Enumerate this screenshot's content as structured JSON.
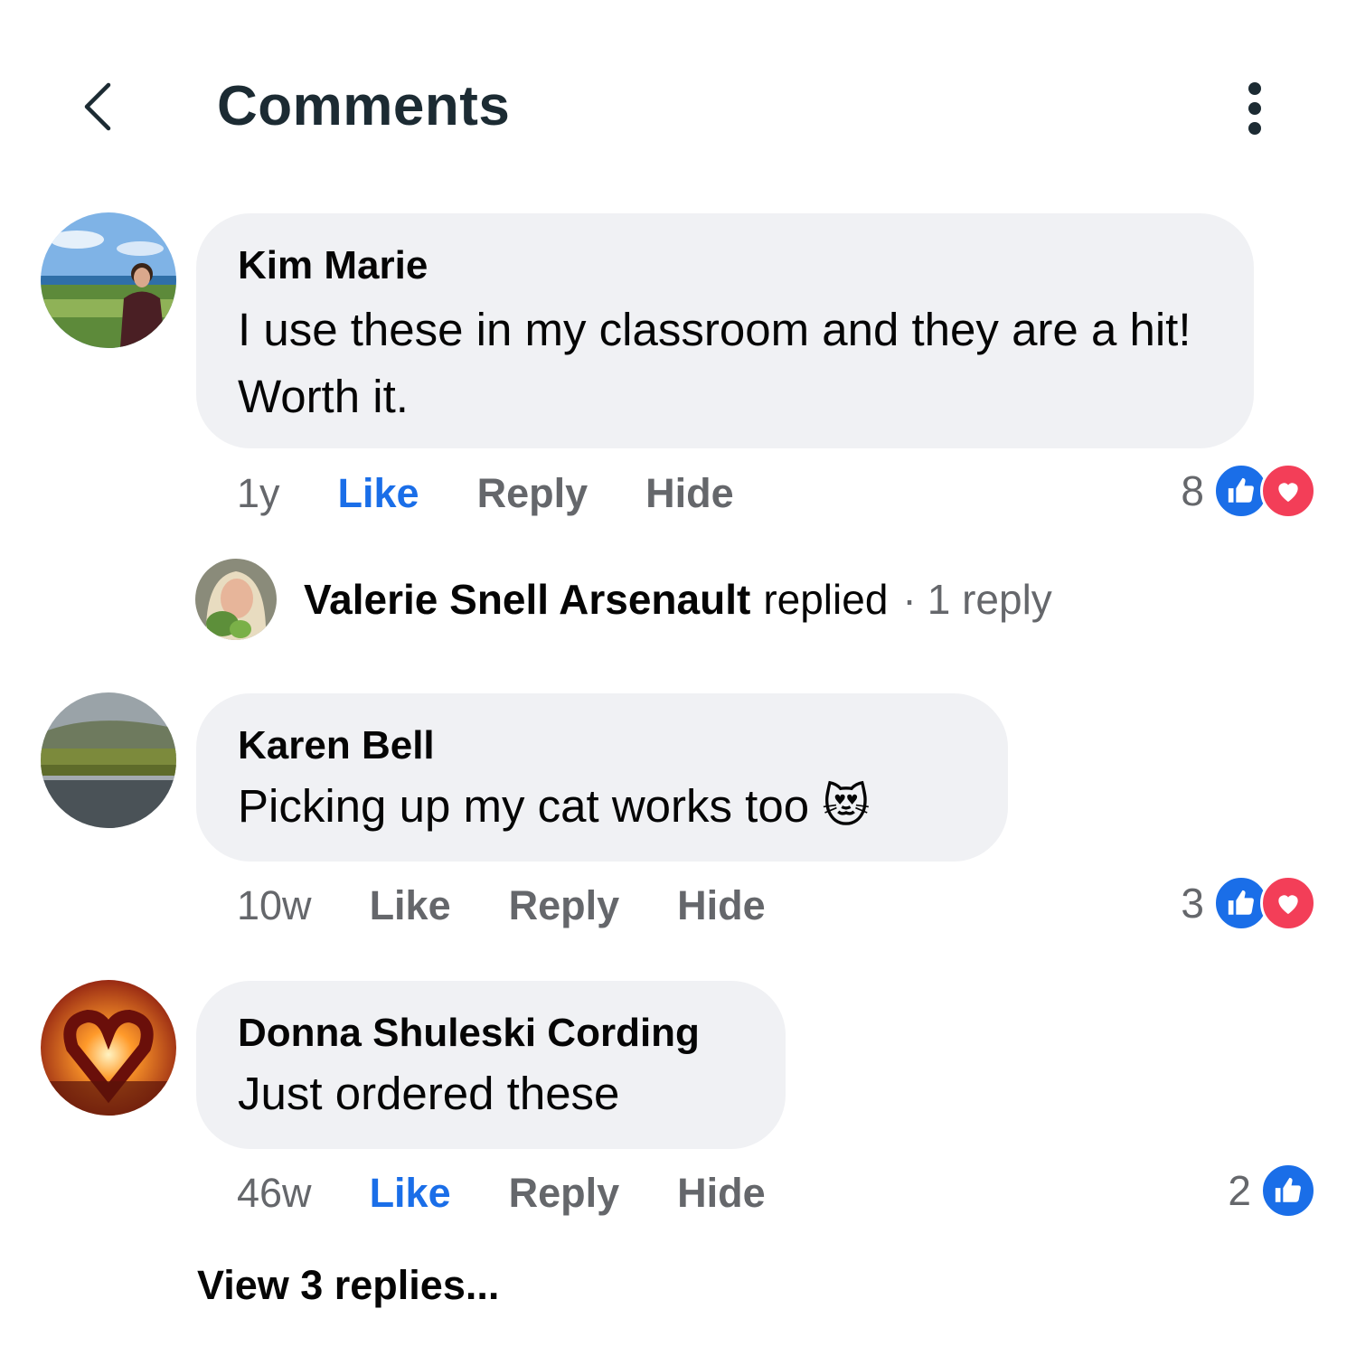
{
  "header": {
    "title": "Comments",
    "back_icon": "chevron-left-icon",
    "more_icon": "vertical-dots-icon"
  },
  "colors": {
    "like_blue": "#1a6ee8",
    "love_red": "#f33e58",
    "bubble": "#f0f1f4",
    "muted": "#65676b"
  },
  "comments": [
    {
      "author": "Kim Marie",
      "text": "I use these in my classroom and they are a hit! Worth it.",
      "time": "1y",
      "like_label": "Like",
      "reply_label": "Reply",
      "hide_label": "Hide",
      "liked": true,
      "reaction_count": "8",
      "reactions": [
        "like",
        "love"
      ]
    },
    {
      "author": "Karen Bell",
      "text": "Picking up my cat works too 😻",
      "time": "10w",
      "like_label": "Like",
      "reply_label": "Reply",
      "hide_label": "Hide",
      "liked": false,
      "reaction_count": "3",
      "reactions": [
        "like",
        "love"
      ]
    },
    {
      "author": "Donna Shuleski Cording",
      "text": "Just ordered these",
      "time": "46w",
      "like_label": "Like",
      "reply_label": "Reply",
      "hide_label": "Hide",
      "liked": true,
      "reaction_count": "2",
      "reactions": [
        "like"
      ]
    }
  ],
  "reply_summary": {
    "name": "Valerie Snell Arsenault",
    "verb": "replied",
    "dot": "·",
    "count": "1 reply"
  },
  "view_replies": "View 3 replies..."
}
